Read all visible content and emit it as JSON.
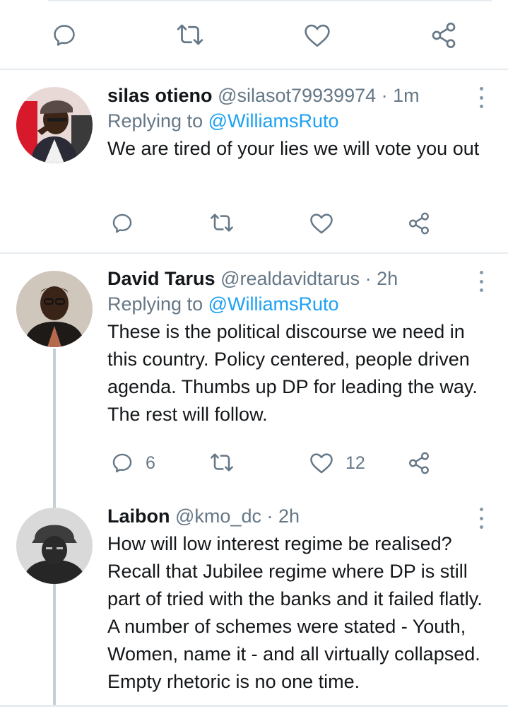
{
  "colors": {
    "accent": "#1da1f2",
    "muted": "#657786",
    "text": "#14171a",
    "divider": "#e6ecf0"
  },
  "top_actions": {
    "icons": [
      "reply-icon",
      "retweet-icon",
      "like-icon",
      "share-icon"
    ]
  },
  "tweets": [
    {
      "name": "silas otieno",
      "handle": "@silasot79939974",
      "time": "· 1m",
      "replying_prefix": "Replying to",
      "replying_to": "@WilliamsRuto",
      "text": "We are tired of your lies we will vote you out",
      "reply_count": "",
      "retweet_count": "",
      "like_count": ""
    },
    {
      "name": "David Tarus",
      "handle": "@realdavidtarus",
      "time": "· 2h",
      "replying_prefix": "Replying to",
      "replying_to": "@WilliamsRuto",
      "text": "These is the political discourse we need in this country. Policy centered, people driven agenda. Thumbs up DP for leading the way. The rest will follow.",
      "reply_count": "6",
      "retweet_count": "",
      "like_count": "12"
    },
    {
      "name": "Laibon",
      "handle": "@kmo_dc",
      "time": "· 2h",
      "text": "How will low interest regime be realised? Recall that Jubilee regime where DP is still part of tried with the banks and it failed flatly. A number of schemes were stated - Youth, Women, name it - and all virtually collapsed. Empty rhetoric is no one time."
    }
  ]
}
